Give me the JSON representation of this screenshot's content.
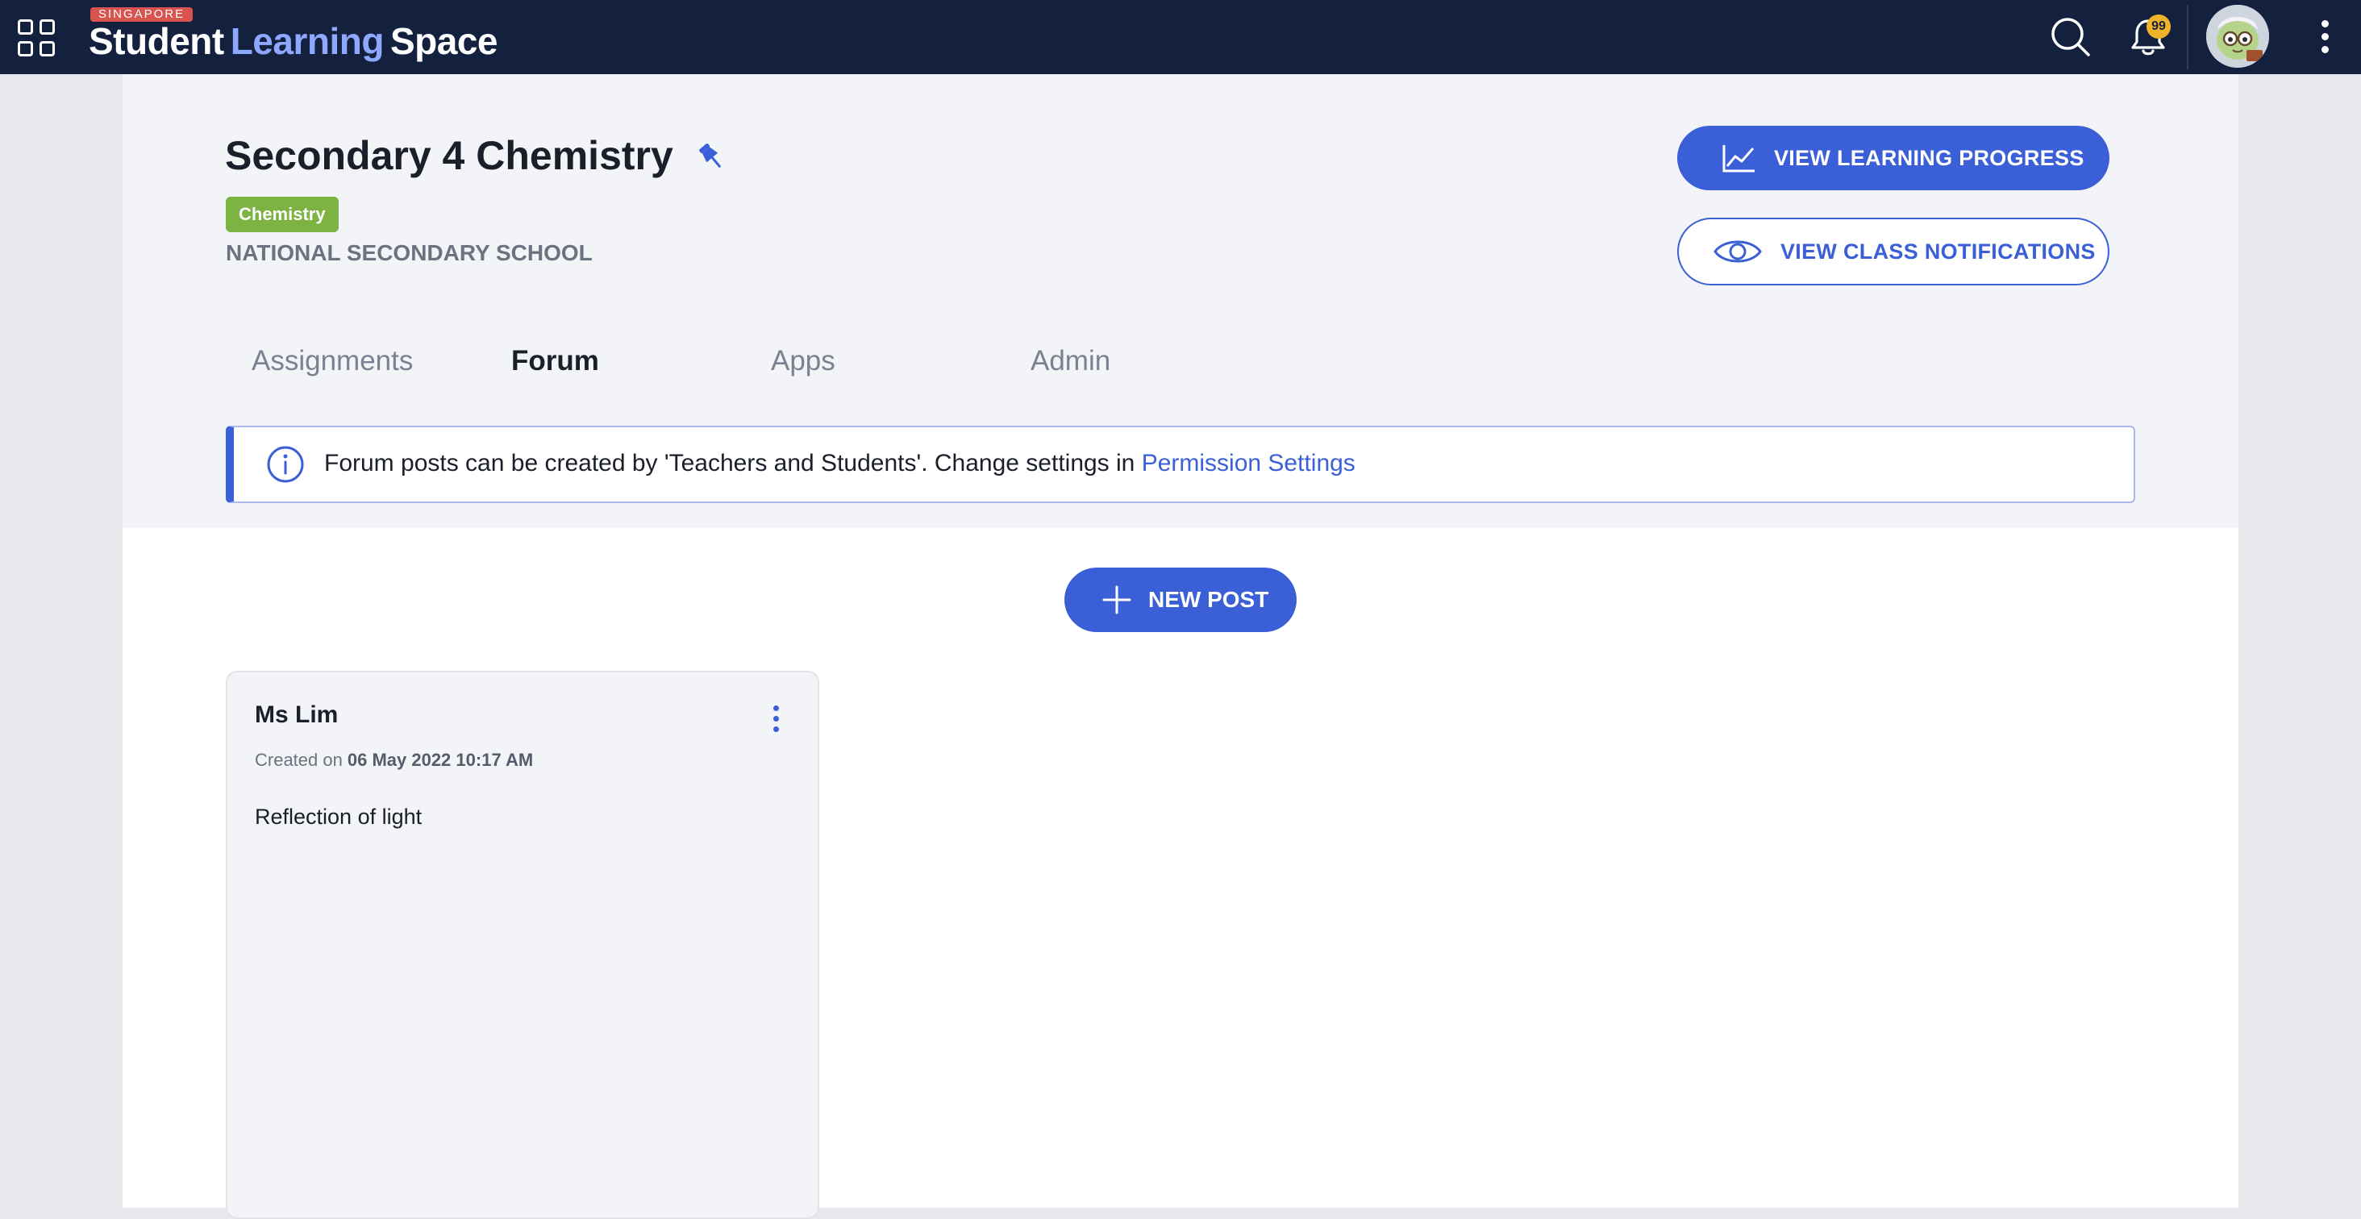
{
  "brand": {
    "tag": "SINGAPORE",
    "name_part1": "Student",
    "name_part2": "Learning",
    "name_part3": "Space"
  },
  "topbar": {
    "notification_count": "99",
    "icons": [
      "apps-grid-icon",
      "search-icon",
      "bell-icon",
      "avatar",
      "more-vertical-icon"
    ]
  },
  "course": {
    "title": "Secondary 4 Chemistry",
    "subject_badge": "Chemistry",
    "school": "NATIONAL SECONDARY SCHOOL"
  },
  "actions": {
    "view_progress_label": "VIEW LEARNING PROGRESS",
    "view_notifications_label": "VIEW CLASS NOTIFICATIONS"
  },
  "tabs": [
    {
      "label": "Assignments",
      "active": false
    },
    {
      "label": "Forum",
      "active": true
    },
    {
      "label": "Apps",
      "active": false
    },
    {
      "label": "Admin",
      "active": false
    }
  ],
  "banner": {
    "text": "Forum posts can be created by 'Teachers and Students'. Change settings in ",
    "link": "Permission Settings"
  },
  "new_post_label": "NEW POST",
  "posts": [
    {
      "author": "Ms Lim",
      "created_prefix": "Created on",
      "created_at": "06 May 2022 10:17 AM",
      "title": "Reflection of light"
    }
  ],
  "colors": {
    "topbar_bg": "#13213f",
    "accent": "#3b5fd6",
    "subject_badge": "#7cb342",
    "notification_badge": "#f0b429",
    "brand_tag": "#d9534f"
  }
}
